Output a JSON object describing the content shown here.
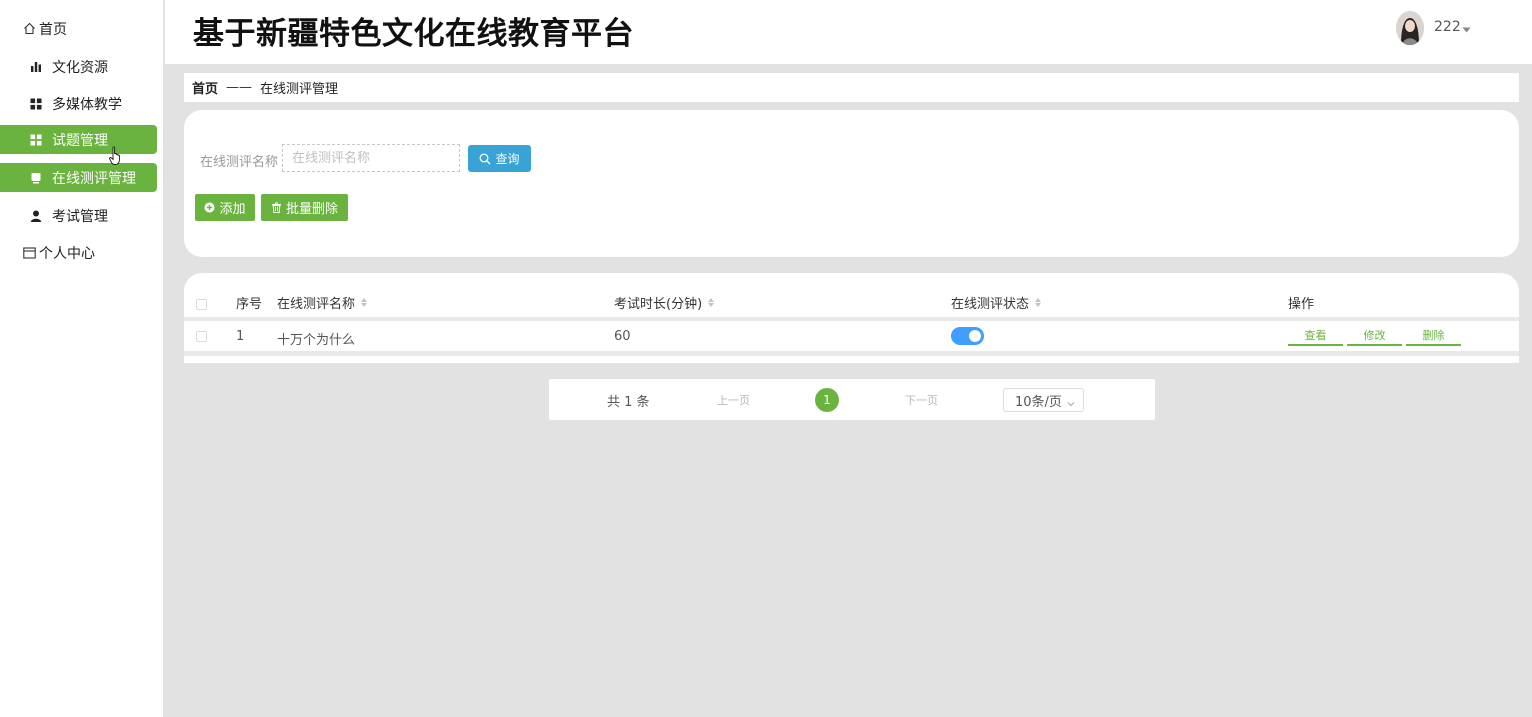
{
  "sidebar": {
    "items": [
      {
        "label": "首页",
        "icon": "home-icon"
      },
      {
        "label": "文化资源",
        "icon": "bar-chart-icon"
      },
      {
        "label": "多媒体教学",
        "icon": "grid-icon"
      },
      {
        "label": "试题管理",
        "icon": "grid-icon"
      },
      {
        "label": "在线测评管理",
        "icon": "monitor-icon"
      },
      {
        "label": "考试管理",
        "icon": "user-icon"
      },
      {
        "label": "个人中心",
        "icon": "card-icon"
      }
    ]
  },
  "header": {
    "title": "基于新疆特色文化在线教育平台",
    "username": "222"
  },
  "breadcrumb": {
    "home": "首页",
    "separator": "——",
    "current": "在线测评管理"
  },
  "search": {
    "label": "在线测评名称",
    "placeholder": "在线测评名称",
    "value": "",
    "query_label": "查询",
    "add_label": "添加",
    "batch_delete_label": "批量删除"
  },
  "table": {
    "columns": [
      "序号",
      "在线测评名称",
      "考试时长(分钟)",
      "在线测评状态",
      "操作"
    ],
    "rows": [
      {
        "index": "1",
        "name": "十万个为什么",
        "duration": "60",
        "status_on": true
      }
    ],
    "actions": [
      "查看",
      "修改",
      "删除"
    ]
  },
  "pagination": {
    "total": "共 1 条",
    "prev": "上一页",
    "current_page": "1",
    "next": "下一页",
    "page_size": "10条/页"
  },
  "colors": {
    "accent": "#6ab33f",
    "query_button": "#38a3d4",
    "toggle": "#409eff",
    "background": "#e2e2e2"
  }
}
